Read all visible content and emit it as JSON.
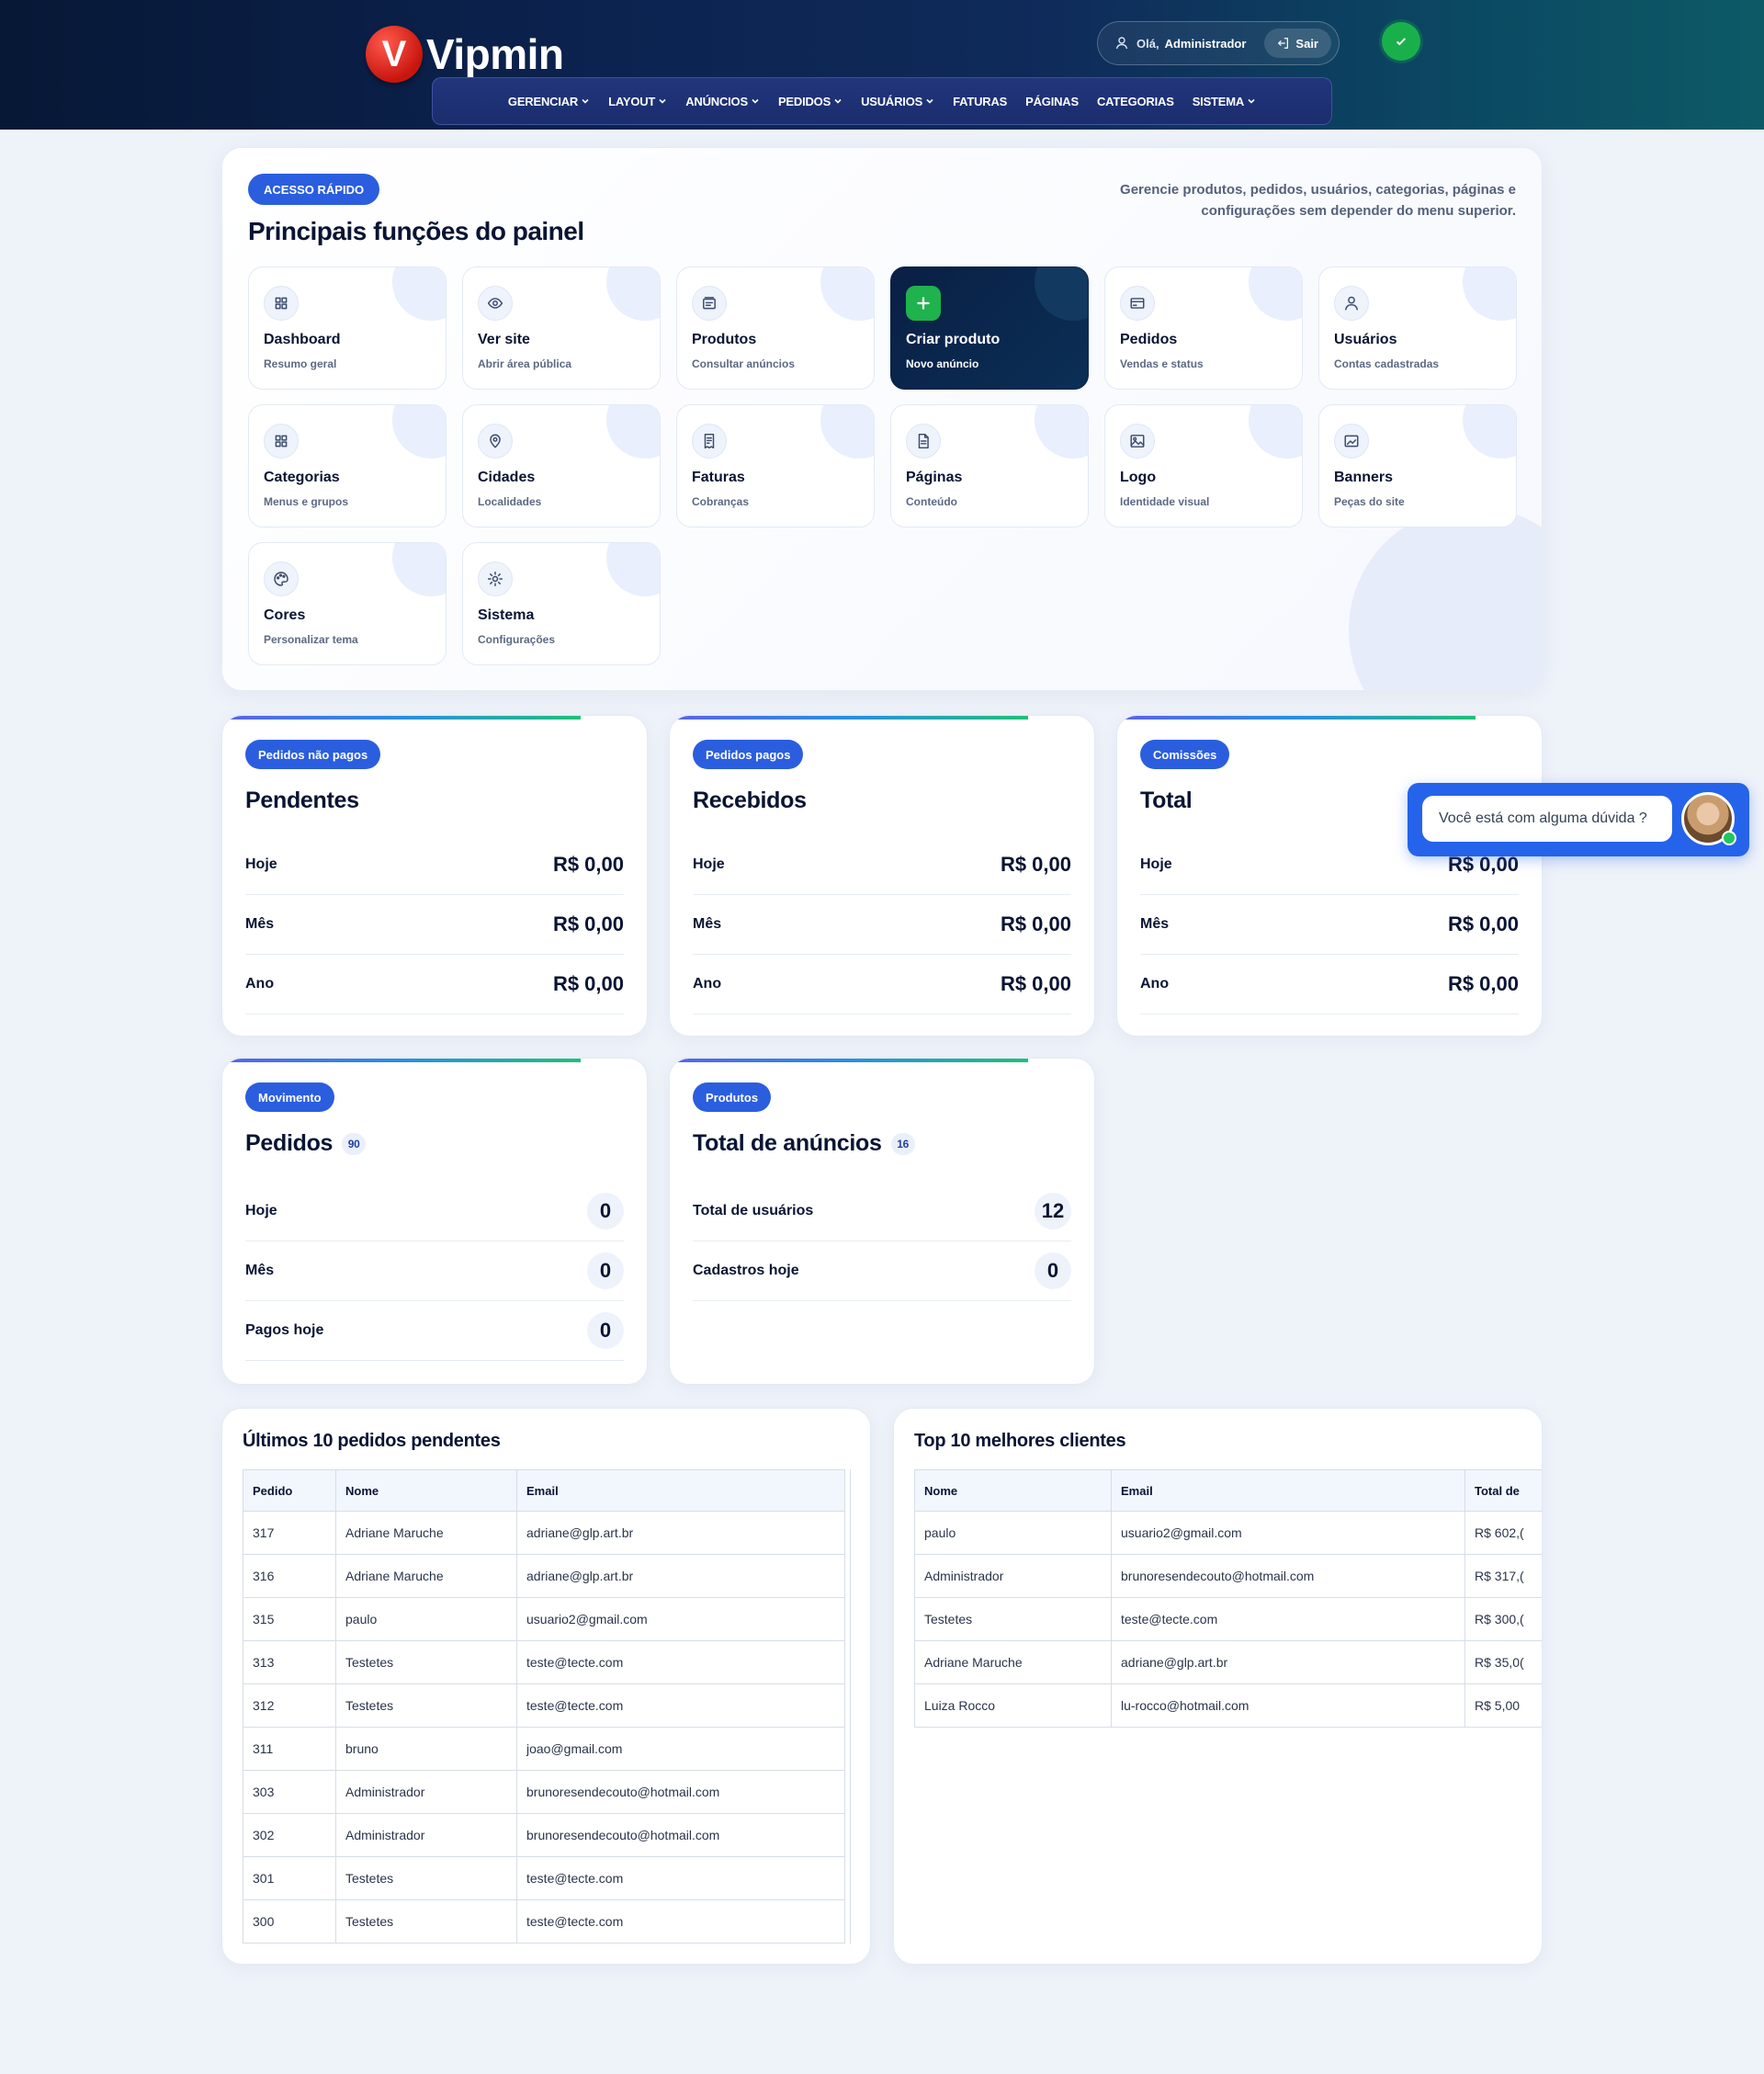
{
  "header": {
    "logo_letter": "V",
    "logo_text": "Vipmin",
    "greeting": "Olá,",
    "user_name": "Administrador",
    "logout_label": "Sair",
    "nav": [
      {
        "label": "GERENCIAR",
        "dropdown": true
      },
      {
        "label": "LAYOUT",
        "dropdown": true
      },
      {
        "label": "ANÚNCIOS",
        "dropdown": true
      },
      {
        "label": "PEDIDOS",
        "dropdown": true
      },
      {
        "label": "USUÁRIOS",
        "dropdown": true
      },
      {
        "label": "FATURAS",
        "dropdown": false
      },
      {
        "label": "PÁGINAS",
        "dropdown": false
      },
      {
        "label": "CATEGORIAS",
        "dropdown": false
      },
      {
        "label": "SISTEMA",
        "dropdown": true
      }
    ]
  },
  "quick": {
    "pill": "ACESSO RÁPIDO",
    "title": "Principais funções do painel",
    "description": "Gerencie produtos, pedidos, usuários, categorias, páginas e configurações sem depender do menu superior.",
    "tiles": [
      {
        "name": "Dashboard",
        "sub": "Resumo geral",
        "icon": "grid-icon"
      },
      {
        "name": "Ver site",
        "sub": "Abrir área pública",
        "icon": "eye-icon"
      },
      {
        "name": "Produtos",
        "sub": "Consultar anúncios",
        "icon": "box-icon"
      },
      {
        "name": "Criar produto",
        "sub": "Novo anúncio",
        "icon": "plus-icon"
      },
      {
        "name": "Pedidos",
        "sub": "Vendas e status",
        "icon": "card-icon"
      },
      {
        "name": "Usuários",
        "sub": "Contas cadastradas",
        "icon": "user-icon"
      },
      {
        "name": "Categorias",
        "sub": "Menus e grupos",
        "icon": "grid-icon"
      },
      {
        "name": "Cidades",
        "sub": "Localidades",
        "icon": "pin-icon"
      },
      {
        "name": "Faturas",
        "sub": "Cobranças",
        "icon": "receipt-icon"
      },
      {
        "name": "Páginas",
        "sub": "Conteúdo",
        "icon": "document-icon"
      },
      {
        "name": "Logo",
        "sub": "Identidade visual",
        "icon": "image-icon"
      },
      {
        "name": "Banners",
        "sub": "Peças do site",
        "icon": "banner-icon"
      },
      {
        "name": "Cores",
        "sub": "Personalizar tema",
        "icon": "palette-icon"
      },
      {
        "name": "Sistema",
        "sub": "Configurações",
        "icon": "gear-icon"
      }
    ]
  },
  "stats": {
    "pendentes": {
      "pill": "Pedidos não pagos",
      "title": "Pendentes",
      "rows": [
        {
          "label": "Hoje",
          "value": "R$ 0,00"
        },
        {
          "label": "Mês",
          "value": "R$ 0,00"
        },
        {
          "label": "Ano",
          "value": "R$ 0,00"
        }
      ]
    },
    "recebidos": {
      "pill": "Pedidos pagos",
      "title": "Recebidos",
      "rows": [
        {
          "label": "Hoje",
          "value": "R$ 0,00"
        },
        {
          "label": "Mês",
          "value": "R$ 0,00"
        },
        {
          "label": "Ano",
          "value": "R$ 0,00"
        }
      ]
    },
    "total": {
      "pill": "Comissões",
      "title": "Total",
      "rows": [
        {
          "label": "Hoje",
          "value": "R$ 0,00"
        },
        {
          "label": "Mês",
          "value": "R$ 0,00"
        },
        {
          "label": "Ano",
          "value": "R$ 0,00"
        }
      ]
    },
    "pedidos": {
      "pill": "Movimento",
      "title": "Pedidos",
      "badge": "90",
      "rows": [
        {
          "label": "Hoje",
          "value": "0"
        },
        {
          "label": "Mês",
          "value": "0"
        },
        {
          "label": "Pagos hoje",
          "value": "0"
        }
      ]
    },
    "produtos": {
      "pill": "Produtos",
      "title": "Total de anúncios",
      "badge": "16",
      "rows": [
        {
          "label": "Total de usuários",
          "value": "12"
        },
        {
          "label": "Cadastros hoje",
          "value": "0"
        }
      ]
    }
  },
  "pending_orders": {
    "title": "Últimos 10 pedidos pendentes",
    "columns": [
      "Pedido",
      "Nome",
      "Email"
    ],
    "rows": [
      [
        "317",
        "Adriane Maruche",
        "adriane@glp.art.br"
      ],
      [
        "316",
        "Adriane Maruche",
        "adriane@glp.art.br"
      ],
      [
        "315",
        "paulo",
        "usuario2@gmail.com"
      ],
      [
        "313",
        "Testetes",
        "teste@tecte.com"
      ],
      [
        "312",
        "Testetes",
        "teste@tecte.com"
      ],
      [
        "311",
        "bruno",
        "joao@gmail.com"
      ],
      [
        "303",
        "Administrador",
        "brunoresendecouto@hotmail.com"
      ],
      [
        "302",
        "Administrador",
        "brunoresendecouto@hotmail.com"
      ],
      [
        "301",
        "Testetes",
        "teste@tecte.com"
      ],
      [
        "300",
        "Testetes",
        "teste@tecte.com"
      ]
    ]
  },
  "top_clients": {
    "title": "Top 10 melhores clientes",
    "columns": [
      "Nome",
      "Email",
      "Total de"
    ],
    "rows": [
      [
        "paulo",
        "usuario2@gmail.com",
        "R$ 602,("
      ],
      [
        "Administrador",
        "brunoresendecouto@hotmail.com",
        "R$ 317,("
      ],
      [
        "Testetes",
        "teste@tecte.com",
        "R$ 300,("
      ],
      [
        "Adriane Maruche",
        "adriane@glp.art.br",
        "R$ 35,0("
      ],
      [
        "Luiza Rocco",
        "lu-rocco@hotmail.com",
        "R$ 5,00"
      ]
    ]
  },
  "chat": {
    "message": "Você está com alguma dúvida ?"
  }
}
